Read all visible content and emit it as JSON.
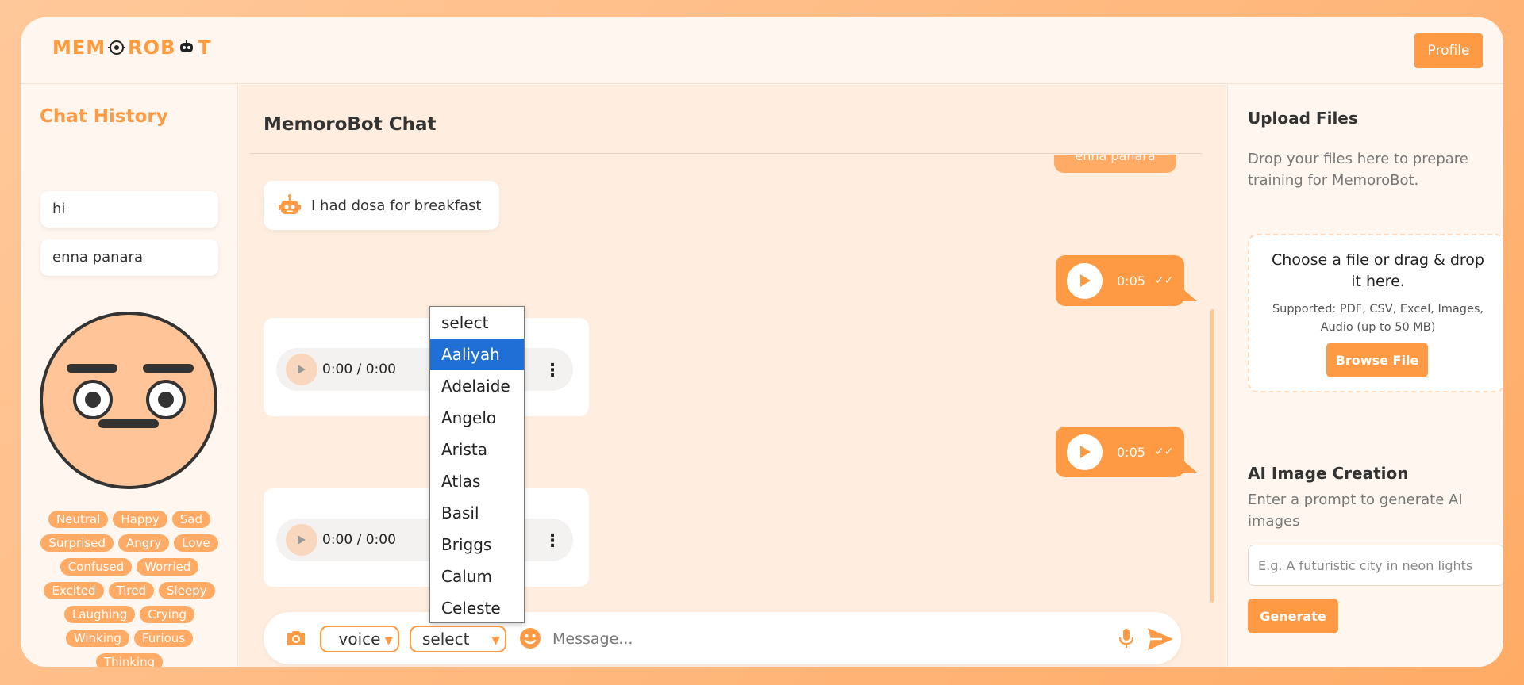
{
  "header": {
    "logo_parts": [
      "MEM",
      "RO",
      "B",
      "T"
    ],
    "profile_label": "Profile"
  },
  "sidebar": {
    "title": "Chat History",
    "history": [
      "hi",
      "enna panara"
    ],
    "emotions": [
      "Neutral",
      "Happy",
      "Sad",
      "Surprised",
      "Angry",
      "Love",
      "Confused",
      "Worried",
      "Excited",
      "Tired",
      "Sleepy",
      "Laughing",
      "Crying",
      "Winking",
      "Furious",
      "Thinking"
    ]
  },
  "chat": {
    "title": "MemoroBot Chat",
    "cut_message": "enna panara",
    "bot_message": "I had dosa for breakfast",
    "voice_messages": [
      {
        "duration": "0:05",
        "ticks": "✓✓"
      },
      {
        "duration": "0:05",
        "ticks": "✓✓"
      }
    ],
    "audio_players": [
      {
        "time": "0:00 / 0:00"
      },
      {
        "time": "0:00 / 0:00"
      }
    ],
    "input": {
      "voice_select": "voice",
      "name_select": "select",
      "message_placeholder": "Message..."
    },
    "dropdown": {
      "options": [
        "select",
        "Aaliyah",
        "Adelaide",
        "Angelo",
        "Arista",
        "Atlas",
        "Basil",
        "Briggs",
        "Calum",
        "Celeste"
      ],
      "highlighted": "Aaliyah"
    }
  },
  "right": {
    "upload_title": "Upload Files",
    "upload_desc": "Drop your files here to prepare training for MemoroBot.",
    "drop_title": "Choose a file or drag & drop it here.",
    "drop_sub": "Supported: PDF, CSV, Excel, Images, Audio (up to 50 MB)",
    "browse_label": "Browse File",
    "ai_title": "AI Image Creation",
    "ai_desc": "Enter a prompt to generate AI images",
    "prompt_placeholder": "E.g. A futuristic city in neon lights",
    "generate_label": "Generate"
  },
  "colors": {
    "accent": "#ff9a44",
    "background": "#fff6ed",
    "selected_option": "#1f6fd6"
  }
}
